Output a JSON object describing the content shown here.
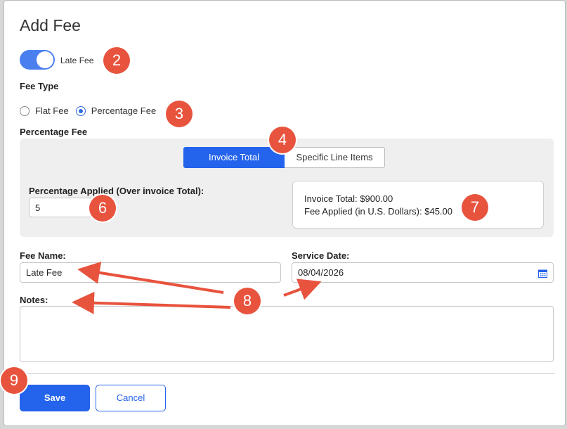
{
  "dialog": {
    "title": "Add Fee",
    "toggle": {
      "label": "Late Fee",
      "on": true
    },
    "fee_type": {
      "label": "Fee Type",
      "options": [
        {
          "label": "Flat Fee",
          "selected": false
        },
        {
          "label": "Percentage Fee",
          "selected": true
        }
      ]
    },
    "percentage_section": {
      "label": "Percentage Fee",
      "tabs": [
        {
          "label": "Invoice Total",
          "active": true
        },
        {
          "label": "Specific Line Items",
          "active": false
        }
      ],
      "percentage_label": "Percentage Applied (Over invoice Total):",
      "percentage_value": "5",
      "summary": {
        "invoice_total": "Invoice Total: $900.00",
        "fee_applied": "Fee Applied (in U.S. Dollars): $45.00"
      }
    },
    "fee_name": {
      "label": "Fee Name:",
      "value": "Late Fee"
    },
    "service_date": {
      "label": "Service Date:",
      "value": "08/04/2026"
    },
    "notes": {
      "label": "Notes:",
      "value": ""
    },
    "buttons": {
      "save": "Save",
      "cancel": "Cancel"
    }
  },
  "annotations": {
    "badges": [
      "2",
      "3",
      "4",
      "6",
      "7",
      "8",
      "9"
    ],
    "color": "#e8533e"
  },
  "colors": {
    "primary": "#2463eb",
    "toggle": "#4a7ff0"
  }
}
